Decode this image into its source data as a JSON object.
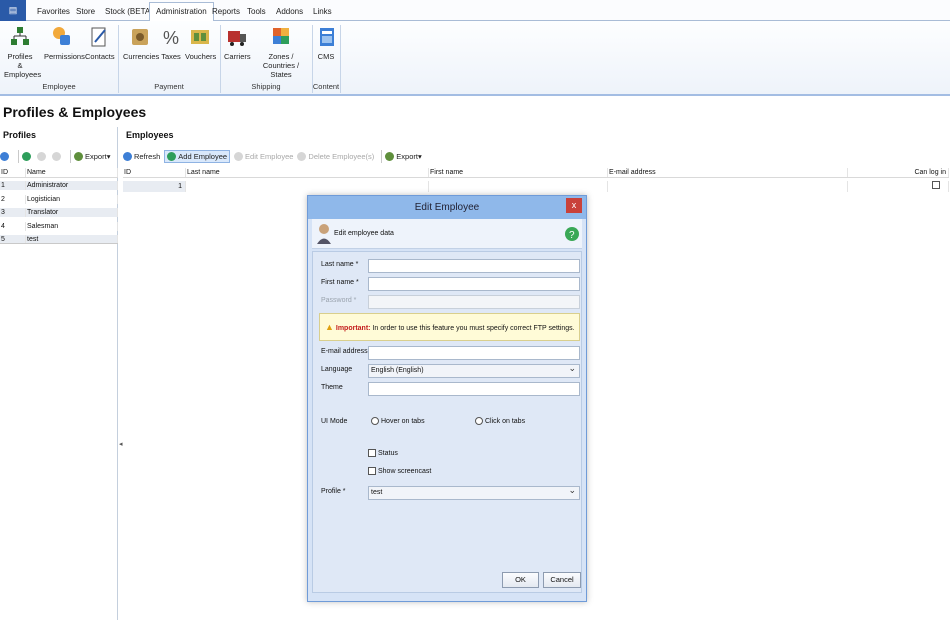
{
  "ribbon_tabs": [
    "Favorites",
    "Store",
    "Stock (BETA)",
    "Administration",
    "Reports",
    "Tools",
    "Addons",
    "Links"
  ],
  "active_tab": "Administration",
  "ribbon": {
    "employee": {
      "label": "Employee",
      "buttons": {
        "profiles": "Profiles &",
        "profiles2": "Employees",
        "permissions": "Permissions",
        "contacts": "Contacts"
      }
    },
    "payment": {
      "label": "Payment",
      "buttons": {
        "currencies": "Currencies",
        "taxes": "Taxes",
        "vouchers": "Vouchers"
      }
    },
    "shipping": {
      "label": "Shipping",
      "buttons": {
        "carriers": "Carriers",
        "zones": "Zones /",
        "zones2": "Countries / States"
      }
    },
    "content": {
      "label": "Content",
      "buttons": {
        "cms": "CMS"
      }
    }
  },
  "page_title": "Profiles & Employees",
  "profiles": {
    "title": "Profiles",
    "export_label": "Export",
    "columns": {
      "id": "ID",
      "name": "Name"
    },
    "rows": [
      {
        "id": "1",
        "name": "Administrator"
      },
      {
        "id": "2",
        "name": "Logistician"
      },
      {
        "id": "3",
        "name": "Translator"
      },
      {
        "id": "4",
        "name": "Salesman"
      },
      {
        "id": "5",
        "name": "test"
      }
    ]
  },
  "employees": {
    "title": "Employees",
    "toolbar": {
      "refresh": "Refresh",
      "add": "Add Employee",
      "edit": "Edit Employee",
      "delete": "Delete Employee(s)",
      "export": "Export"
    },
    "columns": {
      "id": "ID",
      "last_name": "Last name",
      "first_name": "First name",
      "email": "E-mail address",
      "can_log_in": "Can log in"
    },
    "rows": [
      {
        "id": "1"
      }
    ]
  },
  "dialog": {
    "title": "Edit Employee",
    "close": "x",
    "header": "Edit employee data",
    "labels": {
      "last_name": "Last name *",
      "first_name": "First name *",
      "password": "Password *",
      "email": "E-mail address *",
      "language": "Language",
      "theme": "Theme",
      "ui_mode": "UI Mode",
      "profile": "Profile *"
    },
    "warning": {
      "important": "Important:",
      "text": "In order to use this feature you must specify correct FTP settings."
    },
    "language_value": "English (English)",
    "ui_options": {
      "hover": "Hover on tabs",
      "click": "Click on tabs"
    },
    "checkboxes": {
      "status": "Status",
      "screencast": "Show screencast"
    },
    "profile_value": "test",
    "ok": "OK",
    "cancel": "Cancel"
  }
}
